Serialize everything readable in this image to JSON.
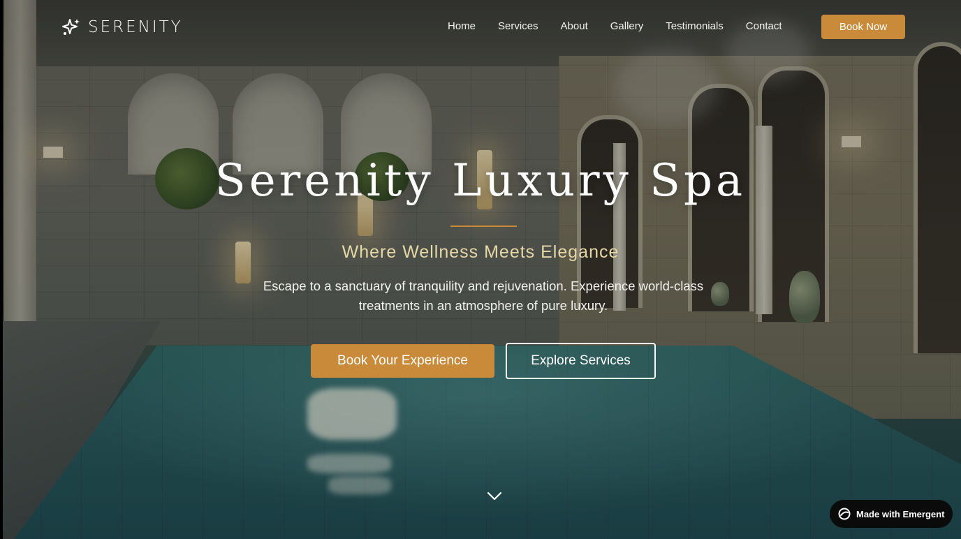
{
  "brand": {
    "name": "SERENITY",
    "logo_icon": "sparkle-icon"
  },
  "nav": {
    "links": [
      "Home",
      "Services",
      "About",
      "Gallery",
      "Testimonials",
      "Contact"
    ],
    "cta_label": "Book Now"
  },
  "hero": {
    "title": "Serenity Luxury Spa",
    "subtitle": "Where Wellness Meets Elegance",
    "description": "Escape to a sanctuary of tranquility and rejuvenation. Experience world-class treatments in an atmosphere of pure luxury.",
    "primary_cta": "Book Your Experience",
    "secondary_cta": "Explore Services",
    "scroll_icon": "chevron-down-icon"
  },
  "badge": {
    "label": "Made with Emergent",
    "icon": "emergent-logo-icon"
  },
  "colors": {
    "accent": "#c98a3a",
    "subtitle": "#e6d7a6",
    "badge_bg": "#0b0b0b"
  }
}
